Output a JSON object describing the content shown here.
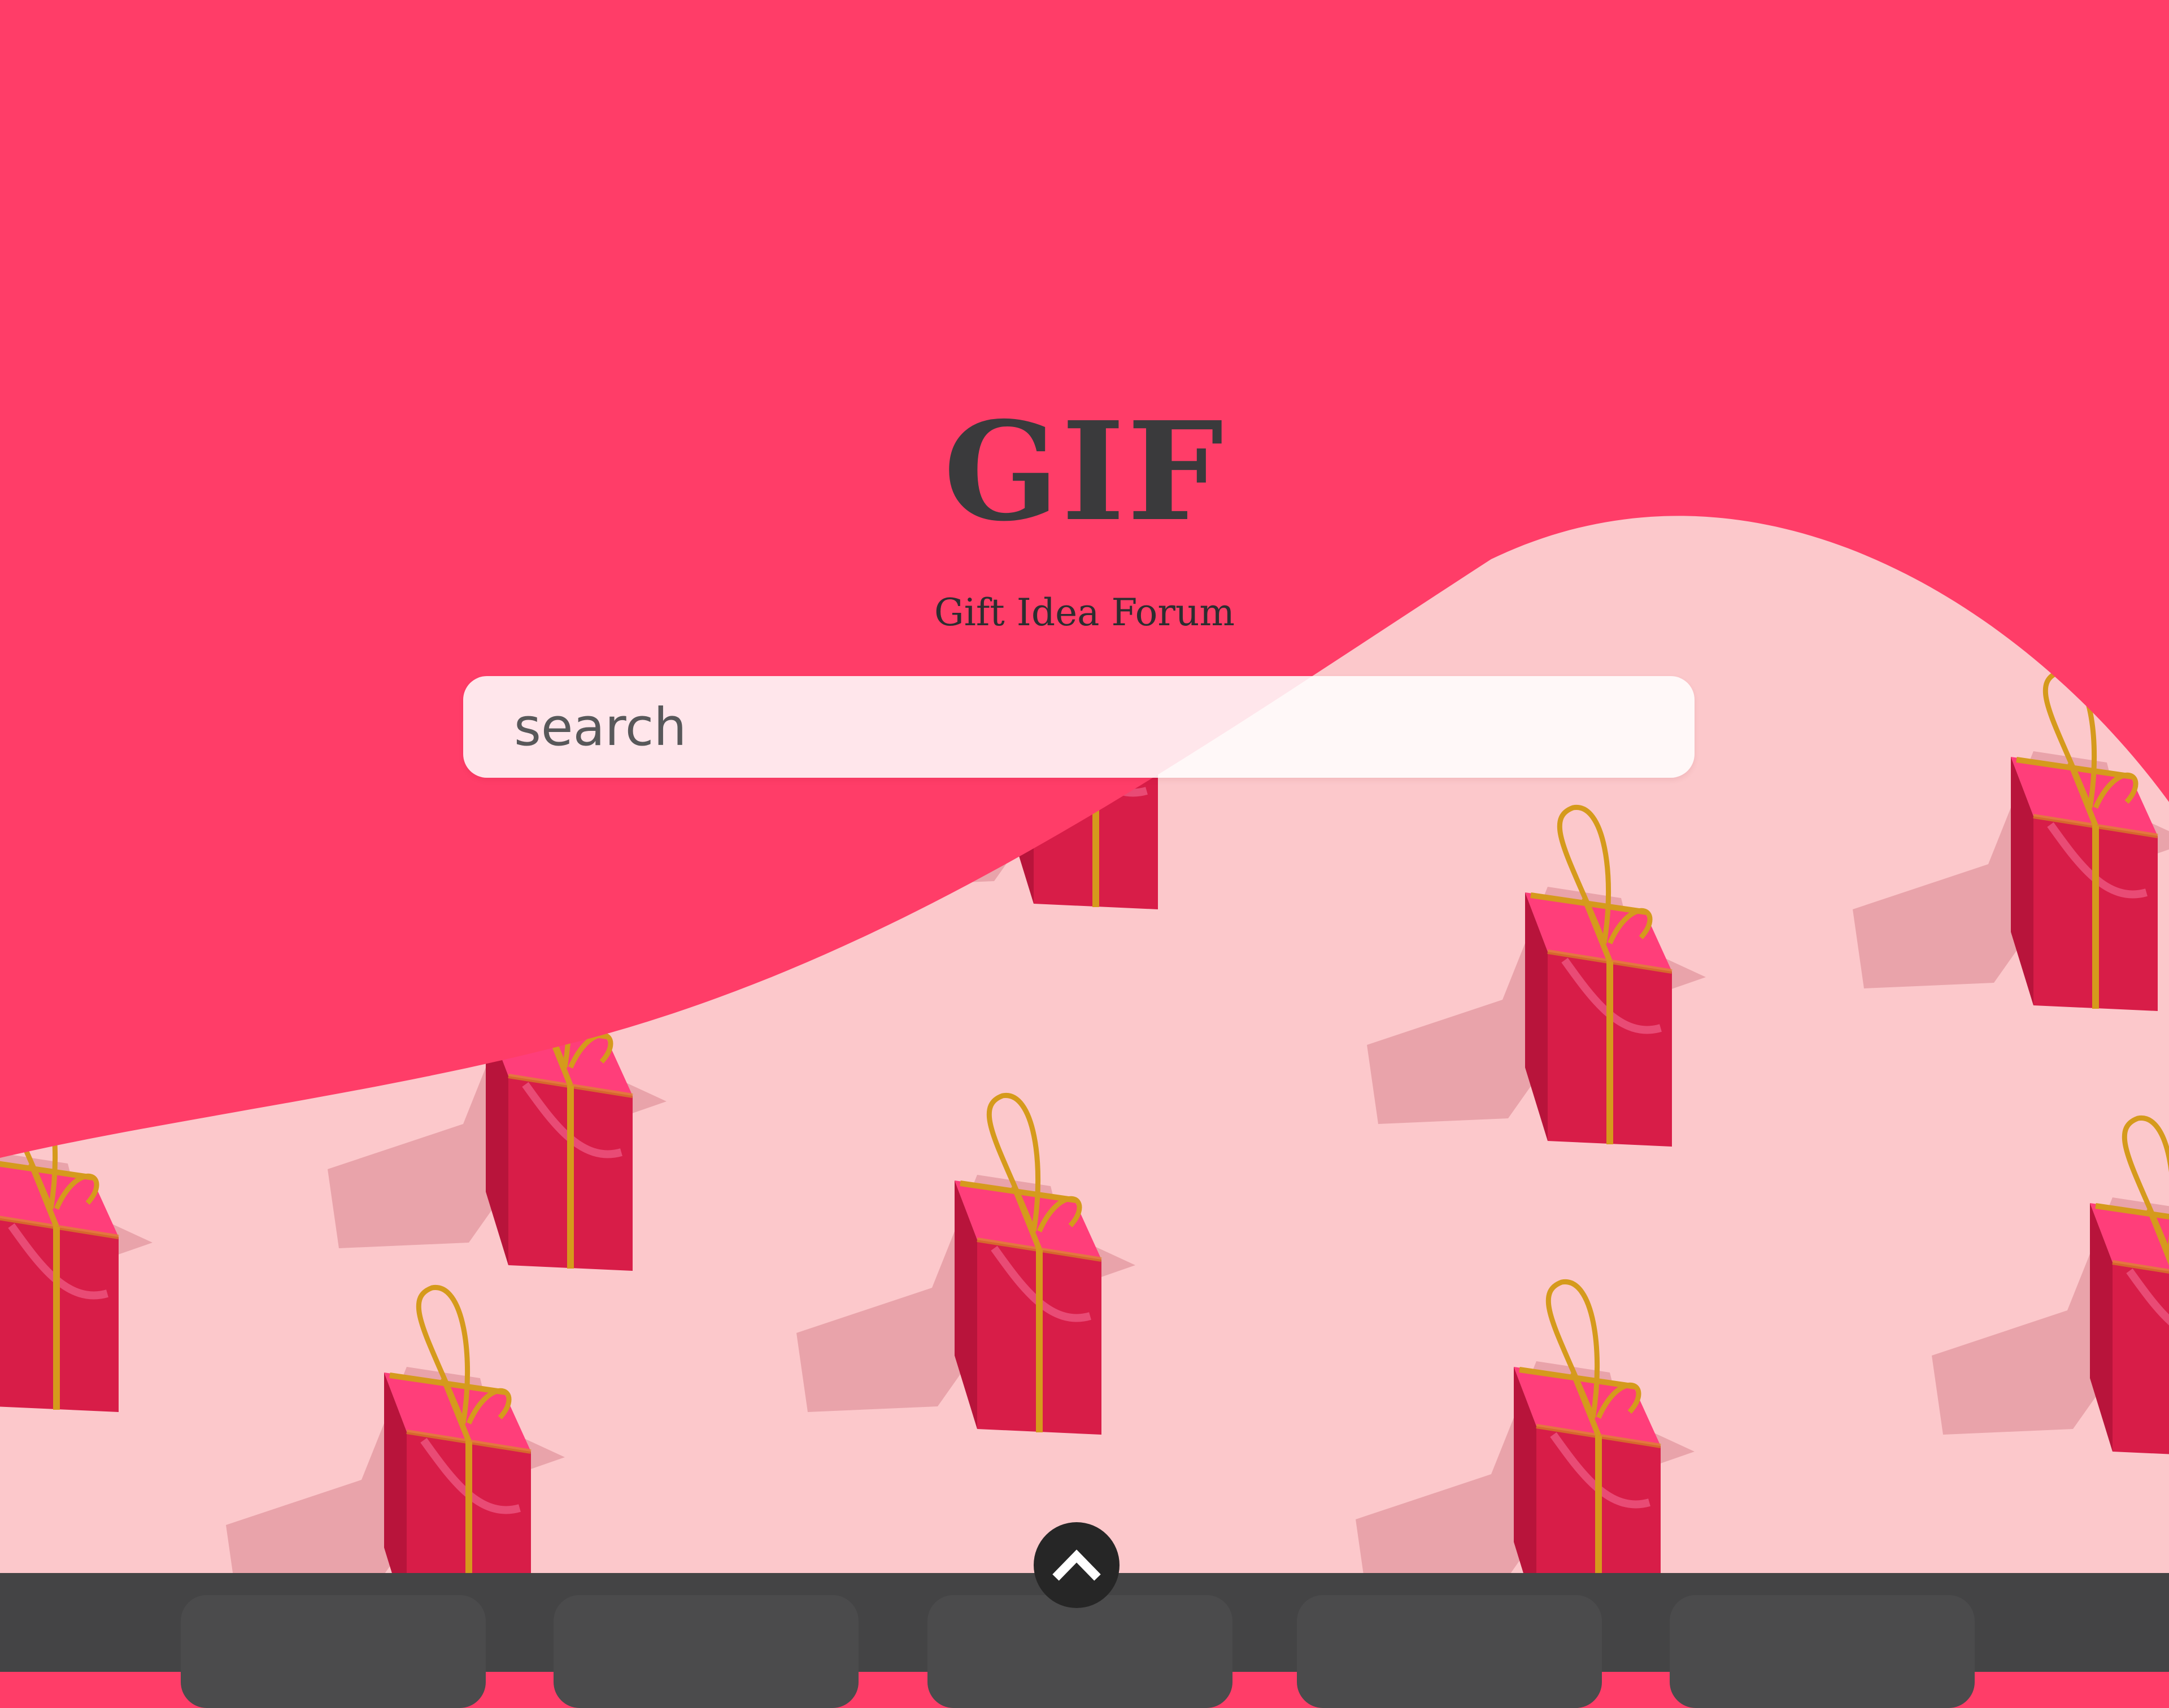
{
  "header": {
    "title": "GIF",
    "subtitle": "Gift Idea Forum"
  },
  "search": {
    "placeholder": "search"
  },
  "icons": {
    "scroll_up": "chevron-up-icon",
    "gift": "gift-box-icon"
  },
  "colors": {
    "brand_pink": "#ff3d68",
    "photo_background": "#fcc8cb",
    "gift_red": "#d81d48",
    "ribbon_gold": "#d59a1c",
    "bottom_bar": "#444445",
    "title_text": "#3a3a3c"
  },
  "bottom_bar": {
    "tiles": [
      "",
      "",
      "",
      "",
      ""
    ]
  }
}
